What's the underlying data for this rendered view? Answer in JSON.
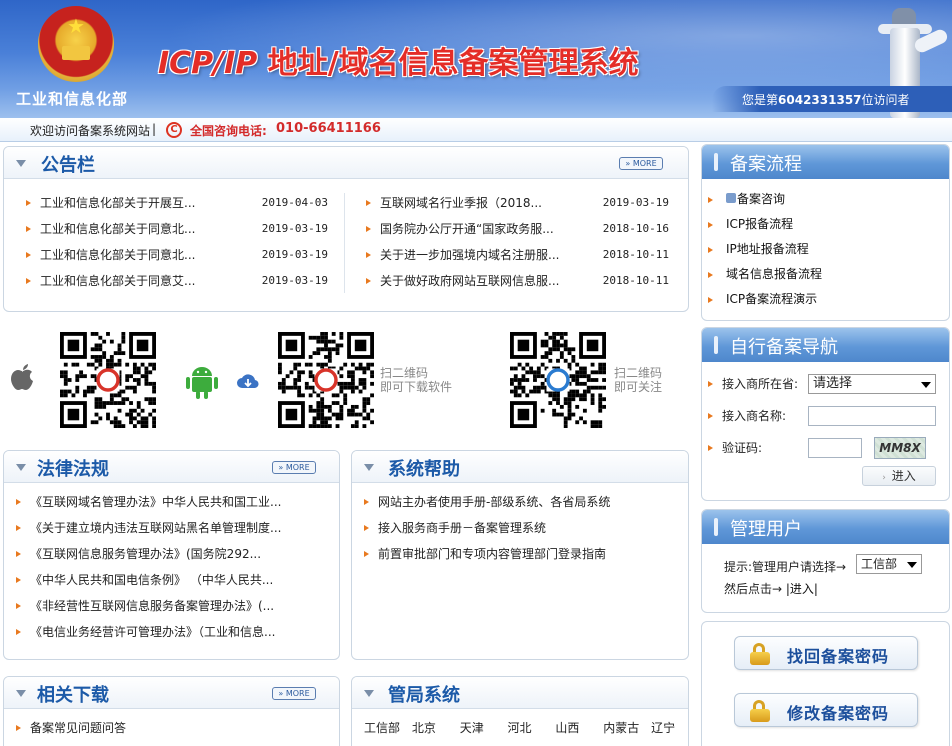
{
  "header": {
    "ministry": "工业和信息化部",
    "title_en": "ICP/IP",
    "title_cn": " 地址/域名信息备案管理系统",
    "visitor_prefix": "您是第",
    "visitor_count": "6042331357",
    "visitor_suffix": "位访问者"
  },
  "welcome": {
    "text": "欢迎访问备案系统网站",
    "sep": "|",
    "hotline_label": "全国咨询电话:",
    "hotline_number": "010-66411166"
  },
  "notice": {
    "title": "公告栏",
    "more": "» MORE",
    "left": [
      {
        "text": "工业和信息化部关于开展互...",
        "date": "2019-04-03"
      },
      {
        "text": "工业和信息化部关于同意北...",
        "date": "2019-03-19"
      },
      {
        "text": "工业和信息化部关于同意北...",
        "date": "2019-03-19"
      },
      {
        "text": "工业和信息化部关于同意艾...",
        "date": "2019-03-19"
      }
    ],
    "right": [
      {
        "text": "互联网域名行业季报（2018...",
        "date": "2019-03-19"
      },
      {
        "text": "国务院办公厅开通“国家政务服...",
        "date": "2018-10-16"
      },
      {
        "text": "关于进一步加强境内域名注册服...",
        "date": "2018-10-11"
      },
      {
        "text": "关于做好政府网站互联网信息服...",
        "date": "2018-10-11"
      }
    ]
  },
  "qr": {
    "download_label_1": "扫二维码",
    "download_label_2": "即可下载软件",
    "follow_label_1": "扫二维码",
    "follow_label_2": "即可关注"
  },
  "law": {
    "title": "法律法规",
    "more": "» MORE",
    "items": [
      "《互联网域名管理办法》中华人民共和国工业...",
      "《关于建立境内违法互联网站黑名单管理制度...",
      "《互联网信息服务管理办法》(国务院292...",
      "《中华人民共和国电信条例》 （中华人民共...",
      "《非经营性互联网信息服务备案管理办法》(...",
      "《电信业务经营许可管理办法》（工业和信息..."
    ]
  },
  "help": {
    "title": "系统帮助",
    "items": [
      "网站主办者使用手册-部级系统、各省局系统",
      "接入服务商手册－备案管理系统",
      "前置审批部门和专项内容管理部门登录指南"
    ]
  },
  "download": {
    "title": "相关下载",
    "more": "» MORE",
    "items": [
      "备案常见问题问答"
    ]
  },
  "bureau": {
    "title": "管局系统",
    "items": [
      "工信部",
      "北京",
      "天津",
      "河北",
      "山西",
      "内蒙古",
      "辽宁"
    ]
  },
  "flow": {
    "title": "备案流程",
    "items": [
      "备案咨询",
      "ICP报备流程",
      "IP地址报备流程",
      "域名信息报备流程",
      "ICP备案流程演示"
    ]
  },
  "nav": {
    "title": "自行备案导航",
    "province_label": "接入商所在省:",
    "province_value": "请选择",
    "name_label": "接入商名称:",
    "captcha_label": "验证码:",
    "captcha_text": "MM8X",
    "enter_label": "进入"
  },
  "admin": {
    "title": "管理用户",
    "tip": "提示:管理用户请选择→",
    "select_value": "工信部",
    "then_click": "然后点击→",
    "enter_link": "|进入|"
  },
  "buttons": {
    "recover": "找回备案密码",
    "modify": "修改备案密码"
  },
  "colors": {
    "brand_blue": "#1c5aa8",
    "accent_red": "#d32b2b",
    "bullet_orange": "#e8791f"
  }
}
